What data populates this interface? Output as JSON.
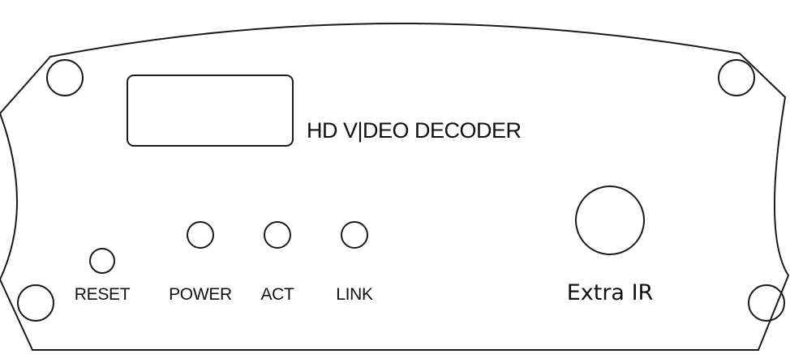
{
  "panel": {
    "title": "HD V|DEO DECODER",
    "labels": {
      "reset": "RESET",
      "power": "POWER",
      "act": "ACT",
      "link": "LINK",
      "extra_ir": "Extra IR"
    }
  },
  "colors": {
    "stroke": "#1a1a1a",
    "background": "#ffffff"
  }
}
